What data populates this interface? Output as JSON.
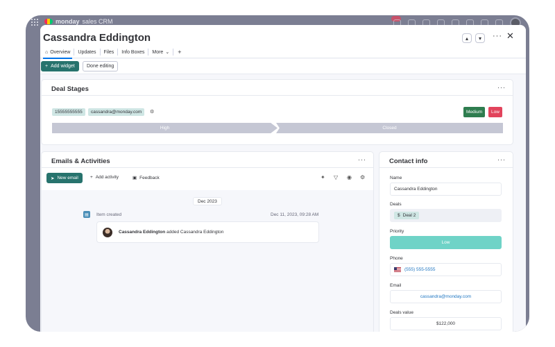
{
  "app": {
    "brand_bold": "monday",
    "brand_rest": "sales CRM"
  },
  "item": {
    "title": "Cassandra Eddington"
  },
  "header": {
    "up_icon": "chevron-up-icon",
    "down_icon": "chevron-down-icon",
    "more": "···",
    "close": "✕"
  },
  "tabs": [
    {
      "label": "Overview",
      "icon": "home-icon",
      "active": true
    },
    {
      "label": "Updates"
    },
    {
      "label": "Files"
    },
    {
      "label": "Info Boxes"
    },
    {
      "label": "More"
    }
  ],
  "tabs_plus": "+",
  "toolbar": {
    "add_widget": "Add widget",
    "done_editing": "Done editing"
  },
  "deal_stages": {
    "title": "Deal Stages",
    "phone_chip": "15555555555",
    "email_chip": "cassandra@monday.com",
    "priority_options": [
      {
        "label": "Medium",
        "color": "#2e7d4f"
      },
      {
        "label": "Low",
        "color": "#e2445c"
      }
    ],
    "stages": [
      "High",
      "Closed"
    ]
  },
  "emails_activities": {
    "title": "Emails & Activities",
    "new_email": "New email",
    "add_activity": "Add activity",
    "feedback": "Feedback",
    "date_group": "Dec 2023",
    "timeline": {
      "label": "Item created",
      "date": "Dec 11, 2023, 09:28 AM",
      "actor": "Cassandra Eddington",
      "action": "added Cassandra Eddington"
    }
  },
  "contact_info": {
    "title": "Contact info",
    "fields": {
      "name_label": "Name",
      "name_value": "Cassandra Eddington",
      "deals_label": "Deals",
      "deals_value": "Deal 2",
      "priority_label": "Priority",
      "priority_value": "Low",
      "priority_color": "#6fd3c7",
      "phone_label": "Phone",
      "phone_value": "(555) 555-5555",
      "email_label": "Email",
      "email_value": "cassandra@monday.com",
      "deals_value_label": "Deals value",
      "deals_value_amount": "$122,000"
    }
  },
  "colors": {
    "accent": "#27736d",
    "link": "#1f76c2"
  }
}
